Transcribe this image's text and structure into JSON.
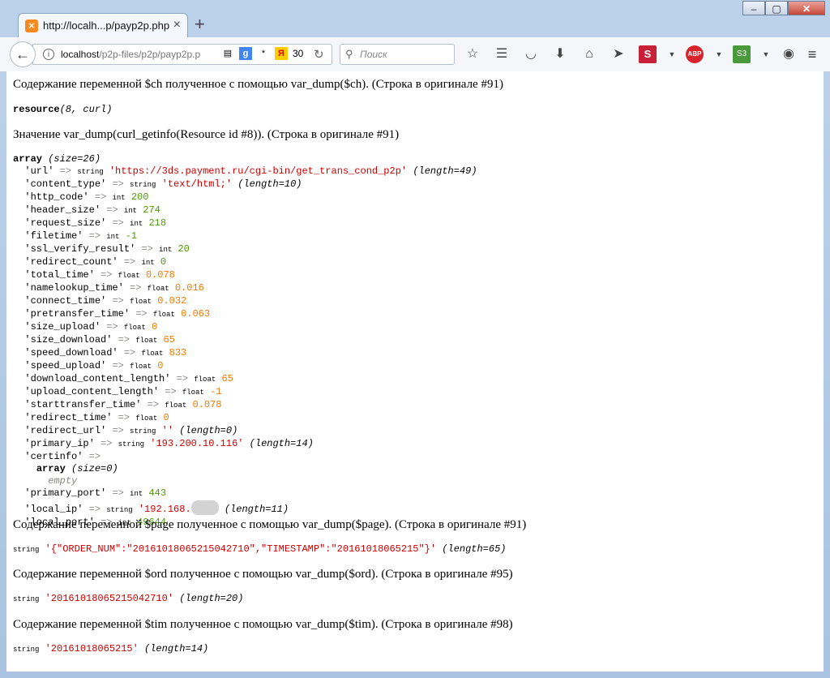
{
  "browser": {
    "tab_title": "http://localh...p/payp2p.php",
    "tab_favicon": "xampp-icon",
    "new_tab": "+",
    "url_host": "localhost",
    "url_path": "/p2p-files/p2p/payp2p.p",
    "yandex_count": "30",
    "search_placeholder": "Поиск",
    "window_buttons": [
      "minimize",
      "maximize",
      "close"
    ]
  },
  "page": {
    "p1": "Содержание переменной $ch полученное с помощью var_dump($ch). (Строка в оригинале #91)",
    "resource_kw": "resource",
    "resource_args": "(8, curl)",
    "p2": "Значение var_dump(curl_getinfo(Resource id #8)). (Строка в оригинале #91)",
    "array_header": {
      "kw": "array",
      "size": "(size=26)"
    },
    "rows": [
      {
        "key": "'url'",
        "type": "string",
        "value": "'https://3ds.payment.ru/cgi-bin/get_trans_cond_p2p'",
        "extra": "(length=49)",
        "cls": "s"
      },
      {
        "key": "'content_type'",
        "type": "string",
        "value": "'text/html;'",
        "extra": "(length=10)",
        "cls": "s"
      },
      {
        "key": "'http_code'",
        "type": "int",
        "value": "200",
        "extra": "",
        "cls": "n"
      },
      {
        "key": "'header_size'",
        "type": "int",
        "value": "274",
        "extra": "",
        "cls": "n"
      },
      {
        "key": "'request_size'",
        "type": "int",
        "value": "218",
        "extra": "",
        "cls": "n"
      },
      {
        "key": "'filetime'",
        "type": "int",
        "value": "-1",
        "extra": "",
        "cls": "n"
      },
      {
        "key": "'ssl_verify_result'",
        "type": "int",
        "value": "20",
        "extra": "",
        "cls": "n"
      },
      {
        "key": "'redirect_count'",
        "type": "int",
        "value": "0",
        "extra": "",
        "cls": "n"
      },
      {
        "key": "'total_time'",
        "type": "float",
        "value": "0.078",
        "extra": "",
        "cls": "f"
      },
      {
        "key": "'namelookup_time'",
        "type": "float",
        "value": "0.016",
        "extra": "",
        "cls": "f"
      },
      {
        "key": "'connect_time'",
        "type": "float",
        "value": "0.032",
        "extra": "",
        "cls": "f"
      },
      {
        "key": "'pretransfer_time'",
        "type": "float",
        "value": "0.063",
        "extra": "",
        "cls": "f"
      },
      {
        "key": "'size_upload'",
        "type": "float",
        "value": "0",
        "extra": "",
        "cls": "f"
      },
      {
        "key": "'size_download'",
        "type": "float",
        "value": "65",
        "extra": "",
        "cls": "f"
      },
      {
        "key": "'speed_download'",
        "type": "float",
        "value": "833",
        "extra": "",
        "cls": "f"
      },
      {
        "key": "'speed_upload'",
        "type": "float",
        "value": "0",
        "extra": "",
        "cls": "f"
      },
      {
        "key": "'download_content_length'",
        "type": "float",
        "value": "65",
        "extra": "",
        "cls": "f"
      },
      {
        "key": "'upload_content_length'",
        "type": "float",
        "value": "-1",
        "extra": "",
        "cls": "f"
      },
      {
        "key": "'starttransfer_time'",
        "type": "float",
        "value": "0.078",
        "extra": "",
        "cls": "f"
      },
      {
        "key": "'redirect_time'",
        "type": "float",
        "value": "0",
        "extra": "",
        "cls": "f"
      },
      {
        "key": "'redirect_url'",
        "type": "string",
        "value": "''",
        "extra": "(length=0)",
        "cls": "s"
      },
      {
        "key": "'primary_ip'",
        "type": "string",
        "value": "'193.200.10.116'",
        "extra": "(length=14)",
        "cls": "s"
      }
    ],
    "certinfo": {
      "key": "'certinfo'",
      "kw": "array",
      "size": "(size=0)",
      "empty": "empty"
    },
    "rows2": [
      {
        "key": "'primary_port'",
        "type": "int",
        "value": "443",
        "extra": "",
        "cls": "n"
      },
      {
        "key": "'local_ip'",
        "type": "string",
        "value": "'192.168.",
        "extra": "(length=11)",
        "cls": "s",
        "blurred": true
      },
      {
        "key": "'local_port'",
        "type": "int",
        "value": "49644",
        "extra": "",
        "cls": "n"
      }
    ],
    "arrow": "=>",
    "p3": "Содержание переменной $page полученное с помощью var_dump($page). (Строка в оригинале #91)",
    "page_dump": {
      "type": "string",
      "value": "'{\"ORDER_NUM\":\"20161018065215042710\",\"TIMESTAMP\":\"20161018065215\"}'",
      "extra": "(length=65)"
    },
    "p4": "Содержание переменной $ord полученное с помощью var_dump($ord). (Строка в оригинале #95)",
    "ord_dump": {
      "type": "string",
      "value": "'20161018065215042710'",
      "extra": "(length=20)"
    },
    "p5": "Содержание переменной $tim полученное с помощью var_dump($tim). (Строка в оригинале #98)",
    "tim_dump": {
      "type": "string",
      "value": "'20161018065215'",
      "extra": "(length=14)"
    }
  },
  "colors": {
    "string": "#cc0000",
    "int": "#4e9a06",
    "float": "#f57900",
    "muted": "#888a85"
  }
}
